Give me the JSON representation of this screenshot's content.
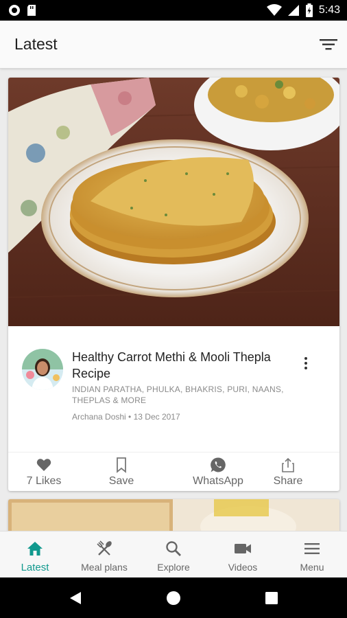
{
  "status_bar": {
    "time": "5:43",
    "icons": [
      "circle-notification-icon",
      "sd-card-icon",
      "wifi-icon",
      "signal-icon",
      "battery-icon"
    ]
  },
  "app_bar": {
    "title": "Latest",
    "filter_icon": "filter-icon"
  },
  "feed": {
    "cards": [
      {
        "title": "Healthy Carrot Methi & Mooli Thepla Recipe",
        "category": "INDIAN PARATHA, PHULKA, BHAKRIS, PURI, NAANS, THEPLAS & MORE",
        "author": "Archana Doshi",
        "date": "13 Dec 2017",
        "meta_separator": " • ",
        "actions": [
          {
            "label": "7 Likes",
            "icon": "heart-icon"
          },
          {
            "label": "Save",
            "icon": "bookmark-icon"
          },
          {
            "label": "WhatsApp",
            "icon": "whatsapp-icon"
          },
          {
            "label": "Share",
            "icon": "share-icon"
          }
        ]
      }
    ]
  },
  "bottom_nav": {
    "items": [
      {
        "label": "Latest",
        "icon": "home-icon",
        "active": true
      },
      {
        "label": "Meal plans",
        "icon": "fork-spoon-icon",
        "active": false
      },
      {
        "label": "Explore",
        "icon": "search-icon",
        "active": false
      },
      {
        "label": "Videos",
        "icon": "video-camera-icon",
        "active": false
      },
      {
        "label": "Menu",
        "icon": "menu-icon",
        "active": false
      }
    ]
  },
  "colors": {
    "accent": "#11998e",
    "icon_gray": "#666666",
    "text_primary": "#222222",
    "text_secondary": "#8a8a8a"
  }
}
